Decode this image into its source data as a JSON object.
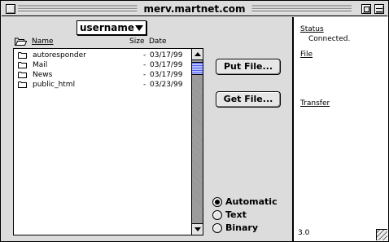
{
  "window": {
    "title": "merv.martnet.com"
  },
  "popup": {
    "value": "username"
  },
  "columns": {
    "name": "Name",
    "size": "Size",
    "date": "Date"
  },
  "files": [
    {
      "name": "autoresponder",
      "size": "-",
      "date": "03/17/99",
      "icon": "folder-icon"
    },
    {
      "name": "Mail",
      "size": "-",
      "date": "03/17/99",
      "icon": "folder-icon"
    },
    {
      "name": "News",
      "size": "-",
      "date": "03/17/99",
      "icon": "folder-icon"
    },
    {
      "name": "public_html",
      "size": "-",
      "date": "03/23/99",
      "icon": "folder-icon"
    }
  ],
  "buttons": {
    "put": "Put File...",
    "get": "Get File..."
  },
  "transfer_mode": {
    "options": [
      "Automatic",
      "Text",
      "Binary"
    ],
    "selected": "Automatic"
  },
  "status_panel": {
    "status_label": "Status",
    "status_value": "Connected.",
    "file_label": "File",
    "transfer_label": "Transfer",
    "version": "3.0"
  },
  "scrollbar": {
    "position_fraction": 0.0
  }
}
